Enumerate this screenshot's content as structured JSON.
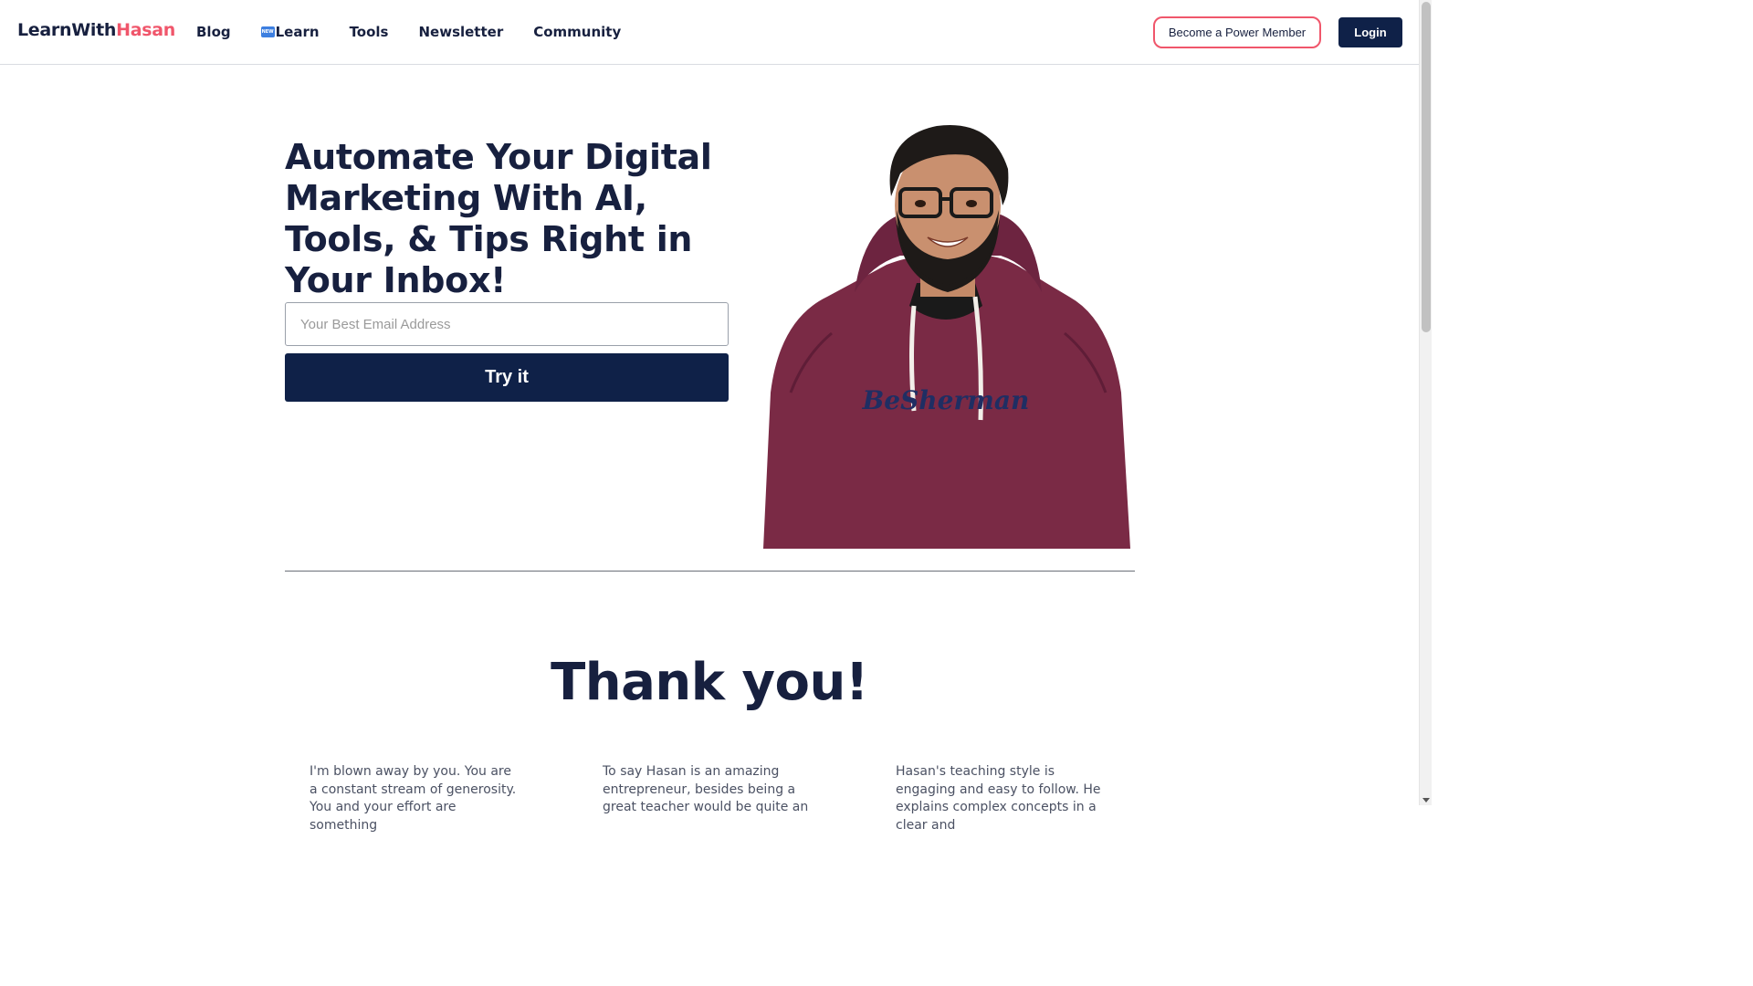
{
  "header": {
    "logo_part1": "LearnWith",
    "logo_part2": "Hasan",
    "nav": [
      {
        "label": "Blog"
      },
      {
        "label": "Learn",
        "badge": "NEW"
      },
      {
        "label": "Tools"
      },
      {
        "label": "Newsletter"
      },
      {
        "label": "Community"
      }
    ],
    "power_member_label": "Become a Power Member",
    "login_label": "Login"
  },
  "hero": {
    "title": "Automate Your Digital Marketing With AI, Tools, & Tips Right in Your Inbox!",
    "email_placeholder": "Your Best Email Address",
    "email_value": "",
    "cta_label": "Try it",
    "portrait_shirt_text": "BeSherman"
  },
  "thanks": {
    "heading": "Thank you!",
    "testimonials": [
      "I'm blown away by you. You are a constant stream of generosity. You and your effort are something",
      "To say Hasan is an amazing entrepreneur, besides being a great teacher would be quite an",
      "Hasan's teaching style is engaging and easy to follow. He explains complex concepts in a clear and"
    ]
  },
  "colors": {
    "navy": "#0f2148",
    "accent_pink": "#f0566b",
    "hoodie": "#7a2a45"
  }
}
